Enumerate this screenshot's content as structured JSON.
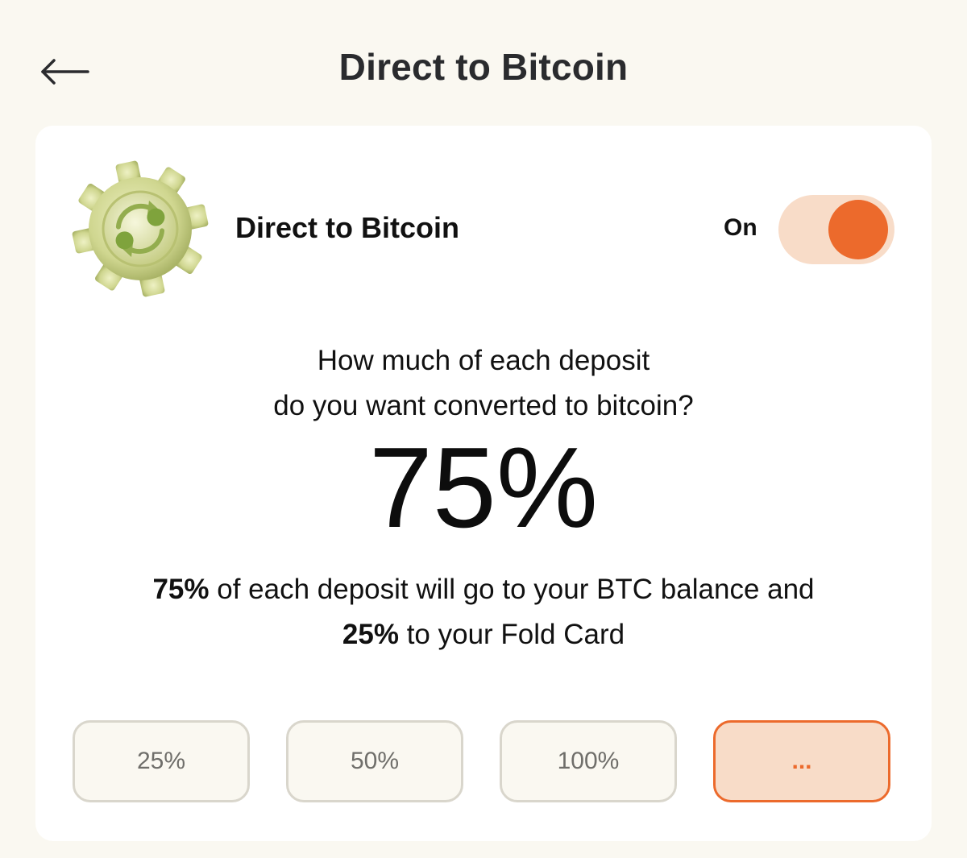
{
  "header": {
    "title": "Direct to Bitcoin",
    "back_icon": "arrow-left-icon"
  },
  "feature": {
    "icon": "gear-convert-icon",
    "name": "Direct to Bitcoin",
    "toggle_label": "On",
    "toggle_on": true
  },
  "question": {
    "line1": "How much of each deposit",
    "line2": "do you want converted to bitcoin?"
  },
  "selected_percent": "75%",
  "summary": {
    "btc_percent": "75%",
    "btc_text": " of each deposit will go to your BTC balance and",
    "card_percent": "25%",
    "card_text": " to your Fold Card"
  },
  "presets": [
    {
      "label": "25%",
      "selected": false
    },
    {
      "label": "50%",
      "selected": false
    },
    {
      "label": "100%",
      "selected": false
    },
    {
      "label": "...",
      "selected": true
    }
  ],
  "colors": {
    "accent": "#ec6a2c",
    "accent_light": "#f8dcc8",
    "background": "#faf8f1",
    "card": "#ffffff"
  }
}
